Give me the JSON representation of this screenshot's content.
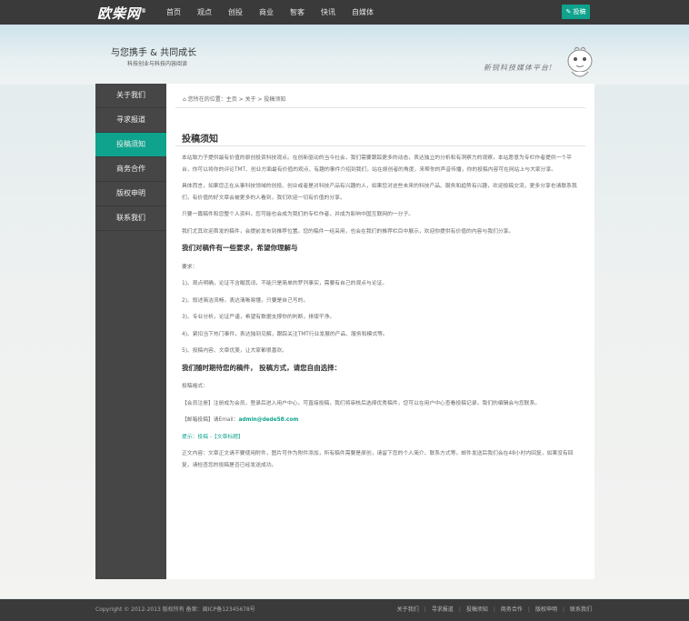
{
  "logo": {
    "text": "欧柴网",
    "mark": "®"
  },
  "nav": [
    "首页",
    "观点",
    "创投",
    "商业",
    "智客",
    "快讯",
    "自媒体"
  ],
  "post_button": "投稿",
  "banner": {
    "title": "与您携手 & 共同成长",
    "subtitle": "科技创业与科技内容阅读",
    "slogan": "新锐科技媒体平台!"
  },
  "sidebar": [
    "关于我们",
    "寻求报道",
    "投稿须知",
    "商务合作",
    "版权申明",
    "联系我们"
  ],
  "breadcrumb": "您所在的位置：主页 > 关于 > 投稿须知",
  "page_title": "投稿须知",
  "paragraphs": [
    "本站致力于提供最有价值的原创投资科技观点。在创新驱动的当今社会，我们需要跟踪更多的动态，表达独立的分析和有洞察力的观察，本站愿意为专栏作者提供一个平台，你可以将你的评论TMT、创业方面最有价值的观点、有趣的事件介绍到我们，站在原创者的角度，来帮你的声音传播，你的投稿内容可在网站上与大家分享。",
    "具体而言，如果您正在从事科技领域的创投、创业或者是对科技产品有兴趣的人，如果您对这些未来的科技产品、服务和趋势有兴趣，欢迎投稿交流，更多分享也请联系我们，有价值的好文章会被更多的人看到，我们欢迎一切有价值的分享。",
    "只要一篇稿件和您整个人资料，您可能也会成为我们的专栏作者，并成为影响中国互联网的一分子。",
    "我们尤其欢迎首发的稿件，会提前发布到推荐位置。您的稿件一经采用，也会在我们的推荐栏目中展示，欢迎你提供有价值的内容与我们分享。"
  ],
  "section1_title": "我们对稿件有一些要求，希望你理解与",
  "requirements_intro": "要求：",
  "requirements": [
    "1)、观点明确，论证不含糊其词，不能只是简单的罗列事实，需要有自己的观点与论证。",
    "2)、叙述简洁流畅，表达清晰易懂，只要是自己写的。",
    "3)、专业分析，论证严谨，希望有数据支撑你的判断，排版干净。",
    "4)、紧扣当下热门事件，表达独到见解，跟踪关注TMT行业发展的产品、服务和模式等。",
    "5)、投稿内容、文章优美，让大家都很喜欢。"
  ],
  "section2_title": "我们随时期待您的稿件， 投稿方式，请您自由选择：",
  "method_intro": "投稿格式：",
  "method_member": "【会员注册】注册成为会员，登录后进入用户中心，可直接投稿，我们将审核后选择优秀稿件，您可以在用户中心查看投稿记录，我们的编辑会与您联系。",
  "method_email_label": "【邮箱投稿】请Email：",
  "email": "admin@dede58.com",
  "tip_label": "提示：",
  "tip_text": "投稿 -【文章标题】",
  "closing": "正文内容：文章正文请不要使用附件，图片可作为附件添加，所有稿件需要是原创，请留下您的个人简介、联系方式等。邮件发送后我们会在48小时内回复，如果没有回复，请检查您的投稿是否已经发送成功。",
  "footer": {
    "copyright": "Copyright © 2012-2013 版权所有 备案：闽ICP备12345678号",
    "links": [
      "关于我们",
      "寻求报道",
      "投稿须知",
      "商务合作",
      "版权申明",
      "联系我们"
    ]
  }
}
